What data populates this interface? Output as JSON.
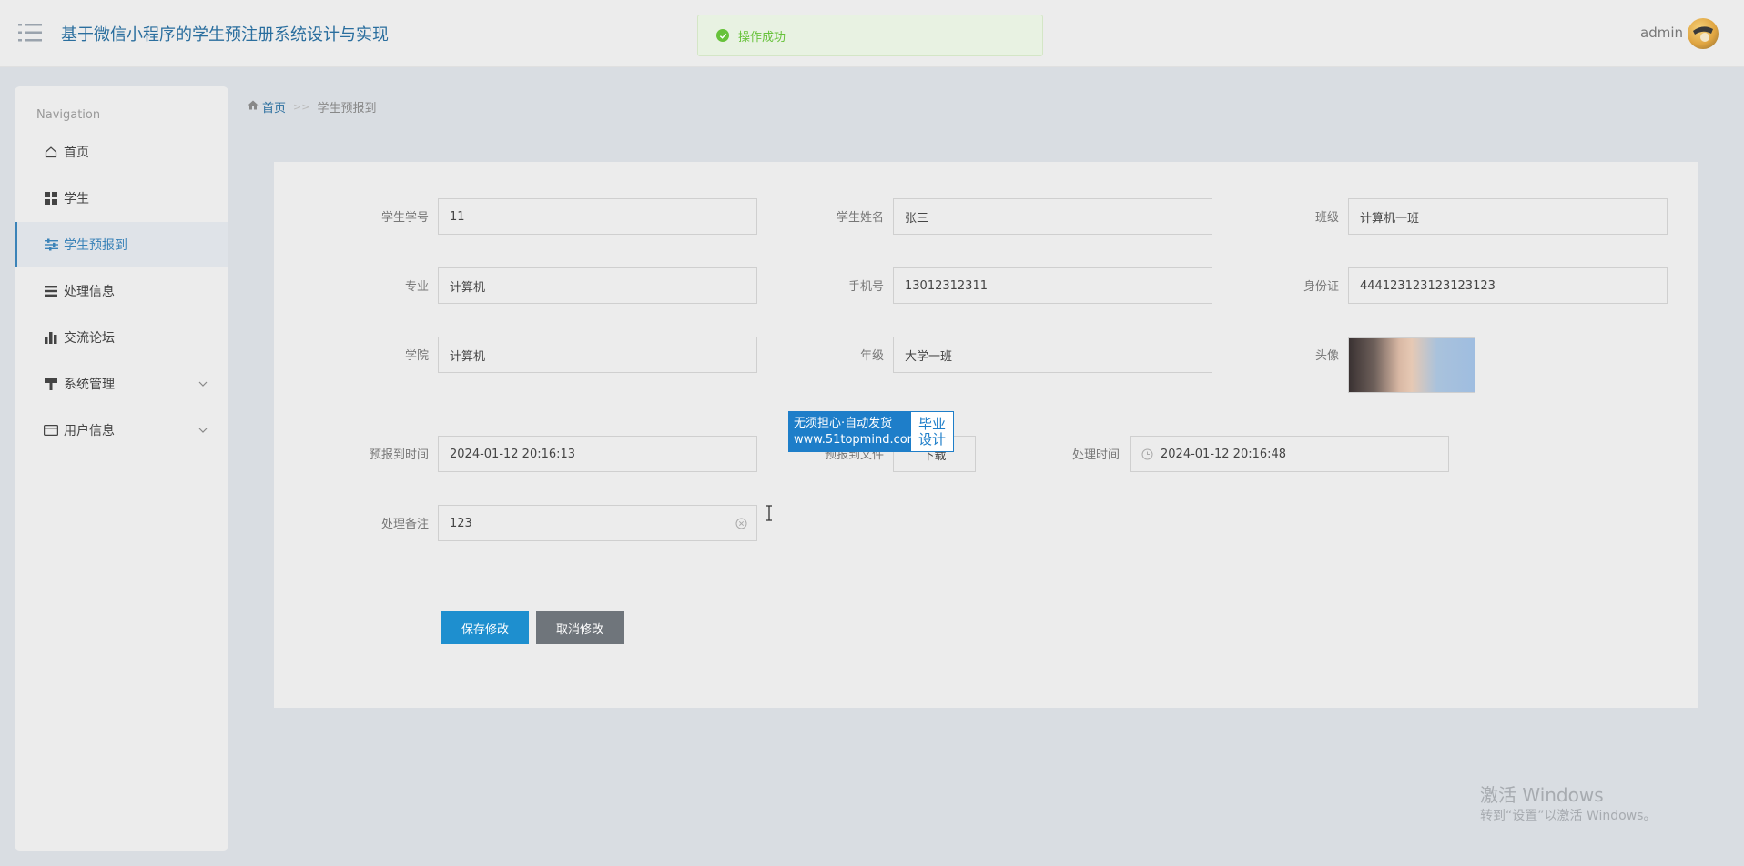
{
  "header": {
    "title": "基于微信小程序的学生预注册系统设计与实现",
    "toast": "操作成功",
    "user": "admin"
  },
  "sidebar": {
    "heading": "Navigation",
    "items": [
      {
        "label": "首页",
        "icon": "home-icon"
      },
      {
        "label": "学生",
        "icon": "grid-icon"
      },
      {
        "label": "学生预报到",
        "icon": "sliders-icon",
        "active": true
      },
      {
        "label": "处理信息",
        "icon": "list-icon"
      },
      {
        "label": "交流论坛",
        "icon": "bar-chart-icon"
      },
      {
        "label": "系统管理",
        "icon": "paint-brush-icon",
        "expandable": true
      },
      {
        "label": "用户信息",
        "icon": "card-icon",
        "expandable": true
      }
    ]
  },
  "breadcrumb": {
    "home": "首页",
    "separator": ">>",
    "current": "学生预报到"
  },
  "form": {
    "student_id_label": "学生学号",
    "student_id": "11",
    "student_name_label": "学生姓名",
    "student_name": "张三",
    "class_label": "班级",
    "class": "计算机一班",
    "major_label": "专业",
    "major": "计算机",
    "phone_label": "手机号",
    "phone": "13012312311",
    "id_card_label": "身份证",
    "id_card": "444123123123123123",
    "college_label": "学院",
    "college": "计算机",
    "grade_label": "年级",
    "grade": "大学一班",
    "avatar_label": "头像",
    "prereg_time_label": "预报到时间",
    "prereg_time": "2024-01-12 20:16:13",
    "prereg_file_label": "预报到文件",
    "prereg_file_button": "下载",
    "process_time_label": "处理时间",
    "process_time": "2024-01-12 20:16:48",
    "process_note_label": "处理备注",
    "process_note": "123",
    "save_button": "保存修改",
    "cancel_button": "取消修改"
  },
  "promo": {
    "line1": "无须担心·自动发货",
    "line2": "www.51topmind.com",
    "badge1": "毕业",
    "badge2": "设计"
  },
  "windows": {
    "activate_title": "激活 Windows",
    "activate_sub": "转到“设置”以激活 Windows。"
  }
}
